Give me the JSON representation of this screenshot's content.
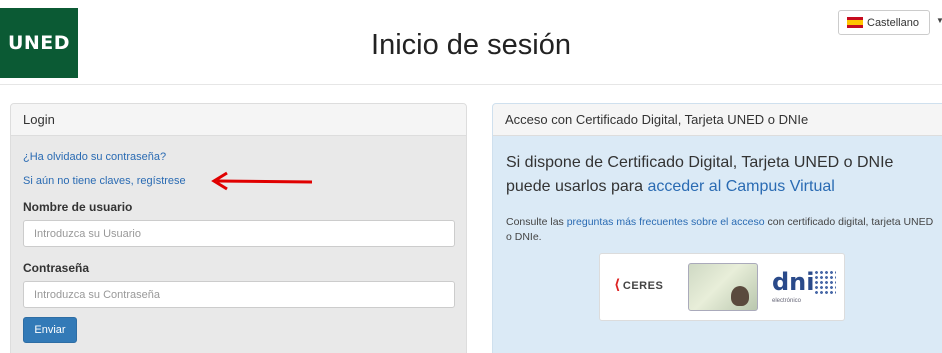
{
  "header": {
    "logo_text": "UNED",
    "title": "Inicio de sesión",
    "language": "Castellano"
  },
  "login": {
    "heading": "Login",
    "forgot_password": "¿Ha olvidado su contraseña?",
    "register": "Si aún no tiene claves, regístrese",
    "username_label": "Nombre de usuario",
    "username_placeholder": "Introduzca su Usuario",
    "password_label": "Contraseña",
    "password_placeholder": "Introduzca su Contraseña",
    "submit": "Enviar"
  },
  "certificate": {
    "heading": "Acceso con Certificado Digital, Tarjeta UNED o DNIe",
    "lead_text": "Si dispone de Certificado Digital, Tarjeta UNED o DNIe puede usarlos para ",
    "lead_link": "acceder al Campus Virtual",
    "note_prefix": "Consulte las ",
    "note_link": "preguntas más frecuentes sobre el acceso",
    "note_suffix": " con certificado digital, tarjeta UNED o DNIe.",
    "logos": {
      "ceres": "CERES",
      "dni": "dni",
      "dni_sub": "electrónico"
    }
  },
  "colors": {
    "brand_green": "#0b5a34",
    "link_blue": "#2a6bb3",
    "button_blue": "#337ab7",
    "annotation_red": "#e00000"
  }
}
